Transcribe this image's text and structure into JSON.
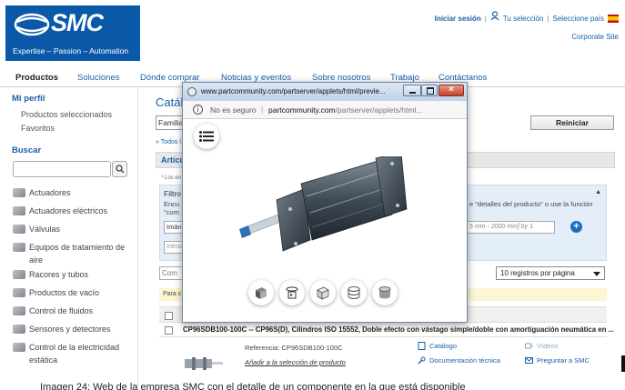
{
  "header": {
    "logo_text": "SMC",
    "tagline": "Expertise – Passion – Automation",
    "login": "Iniciar sesión",
    "your_selection": "Tu selección",
    "select_country": "Seleccione país",
    "corporate_site": "Corporate Site"
  },
  "nav": {
    "items": [
      "Productos",
      "Soluciones",
      "Dónde comprar",
      "Noticias y eventos",
      "Sobre nosotros",
      "Trabajo",
      "Contáctanos"
    ]
  },
  "sidebar": {
    "profile_title": "Mi perfil",
    "profile_links": [
      "Productos seleccionados",
      "Favoritos"
    ],
    "search_title": "Buscar",
    "search_value": "",
    "categories": [
      "Actuadores",
      "Actuadores eléctricos",
      "Válvulas",
      "Equipos de tratamiento de aire",
      "Racores y tubos",
      "Productos de vacío",
      "Control de fluidos",
      "Sensores y detectores",
      "Control de la electricidad estática"
    ]
  },
  "content": {
    "catalog_title": "Catálogo",
    "family_field": "Familia",
    "reset_button": "Reiniciar",
    "all_link": "» Todos l",
    "tab_label": "Artícul",
    "los_en": "* Los en",
    "filter_title": "Filtro",
    "filter_line1": "Encu",
    "filter_line2": "\"com",
    "filter_help": "e \"detalles del producto\" o use la función",
    "imaging_field": "Imán",
    "range_placeholder": "5 mm - 2000 mm] by 1",
    "intro_placeholder": "Introd",
    "compare_field": "Com",
    "records_select": "10 registros por página",
    "notice": "Para c",
    "product_title": "CP96SDB100-100C -- CP96S(D), Cilindros ISO 15552, Doble efecto con vástago simple/doble con amortiguación neumática en ...",
    "reference": "Referencia: CP96SDB100-100C",
    "add_selection": "Añadir a la selección de producto",
    "resources": {
      "catalog": "Catálogo",
      "videos": "Vídeos",
      "tech_doc": "Documentación técnica",
      "ask_smc": "Preguntar a SMC"
    }
  },
  "popup": {
    "title": "www.partcommunity.com/partserver/applets/html/previe...",
    "not_secure": "No es seguro",
    "url_host": "partcommunity.com",
    "url_path": "/partserver/applets/html..."
  },
  "caption": "Imagen 24: Web de la empresa SMC con el detalle de un componente en la que está disponible",
  "colors": {
    "brand_blue": "#0a58a8",
    "link_blue": "#1a5fa8",
    "filter_panel": "#e4eef8",
    "notice_bar": "#fdf6d3"
  }
}
